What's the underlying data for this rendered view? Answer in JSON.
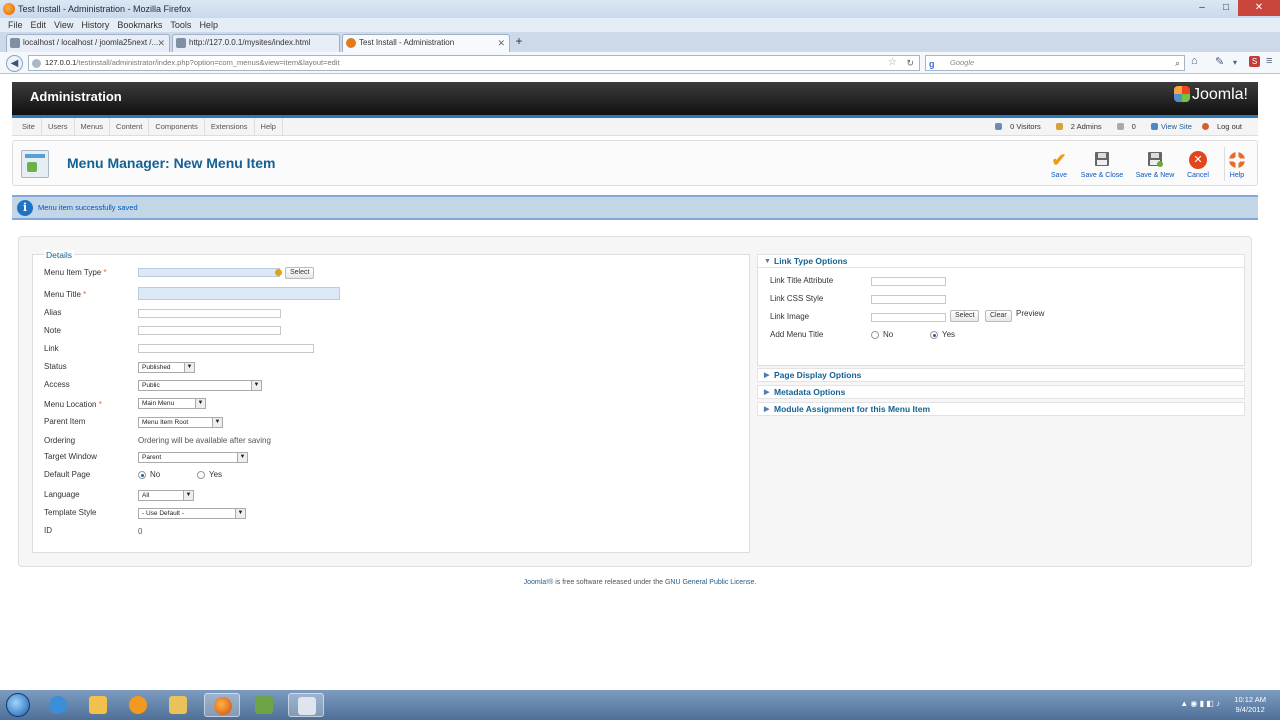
{
  "browser": {
    "window_title": "Test Install - Administration - Mozilla Firefox",
    "menus": [
      "File",
      "Edit",
      "View",
      "History",
      "Bookmarks",
      "Tools",
      "Help"
    ],
    "tabs": [
      {
        "label": "localhost / localhost / joomla25next /..."
      },
      {
        "label": "http://127.0.0.1/mysites/index.html"
      },
      {
        "label": "Test Install - Administration"
      }
    ],
    "url_domain": "127.0.0.1",
    "url_path": "/testinstall/administrator/index.php?option=com_menus&view=item&layout=edit",
    "search_placeholder": "Google"
  },
  "header": {
    "title": "Administration",
    "logo_text": "Joomla!"
  },
  "admin_menu": {
    "items": [
      "Site",
      "Users",
      "Menus",
      "Content",
      "Components",
      "Extensions",
      "Help"
    ],
    "status": {
      "visitors": "0 Visitors",
      "admins": "2 Admins",
      "messages": "0",
      "view_site": "View Site",
      "logout": "Log out"
    }
  },
  "toolbar": {
    "page_title": "Menu Manager: New Menu Item",
    "buttons": [
      {
        "label": "Save",
        "icon": "check-icon",
        "color": "#f09a1a"
      },
      {
        "label": "Save & Close",
        "icon": "save-icon",
        "color": "#555555"
      },
      {
        "label": "Save & New",
        "icon": "save-new-icon",
        "color": "#555555"
      },
      {
        "label": "Cancel",
        "icon": "cancel-icon",
        "color": "#e2461d"
      },
      {
        "label": "Help",
        "icon": "help-icon",
        "color": "#e86b27"
      }
    ]
  },
  "message": "Menu item successfully saved",
  "details": {
    "legend": "Details",
    "fields": {
      "menu_item_type": {
        "label": "Menu Item Type",
        "required": "*",
        "button": "Select"
      },
      "menu_title": {
        "label": "Menu Title",
        "required": "*",
        "value": ""
      },
      "alias": {
        "label": "Alias",
        "value": ""
      },
      "note": {
        "label": "Note",
        "value": ""
      },
      "link": {
        "label": "Link",
        "value": ""
      },
      "status": {
        "label": "Status",
        "value": "Published"
      },
      "access": {
        "label": "Access",
        "value": "Public"
      },
      "menu_location": {
        "label": "Menu Location",
        "required": "*",
        "value": "Main Menu"
      },
      "parent_item": {
        "label": "Parent Item",
        "value": "Menu Item Root"
      },
      "ordering": {
        "label": "Ordering",
        "value": "Ordering will be available after saving"
      },
      "target_window": {
        "label": "Target Window",
        "value": "Parent"
      },
      "default_page": {
        "label": "Default Page",
        "options": [
          "No",
          "Yes"
        ],
        "selected": "No"
      },
      "language": {
        "label": "Language",
        "value": "All"
      },
      "template_style": {
        "label": "Template Style",
        "value": "- Use Default -"
      },
      "id": {
        "label": "ID",
        "value": "0"
      }
    }
  },
  "link_type_options": {
    "title": "Link Type Options",
    "link_title_attribute": "Link Title Attribute",
    "link_css_style": "Link CSS Style",
    "link_image": "Link Image",
    "select_button": "Select",
    "clear_button": "Clear",
    "preview": "Preview",
    "add_menu_title": {
      "label": "Add Menu Title",
      "options": [
        "No",
        "Yes"
      ],
      "selected": "Yes"
    }
  },
  "collapsed_panels": [
    "Page Display Options",
    "Metadata Options",
    "Module Assignment for this Menu Item"
  ],
  "footer": {
    "joomla": "Joomla!®",
    "text": " is free software released under the ",
    "license": "GNU General Public License",
    "end": "."
  },
  "taskbar": {
    "time": "10:12 AM",
    "date": "9/4/2012"
  }
}
